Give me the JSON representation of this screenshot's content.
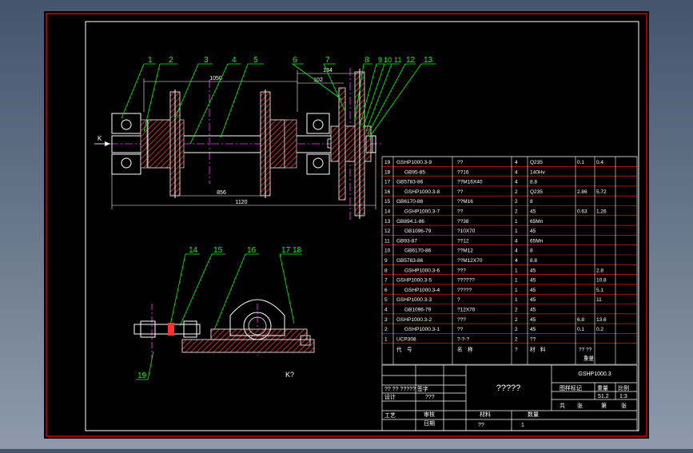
{
  "colors": {
    "background": "#000000",
    "frame": "#ff0000",
    "outline": "#ffffff",
    "leader": "#00ff00",
    "text": "#ffffff",
    "hatch": "#ff3030",
    "centerline": "#ff40ff",
    "dimension": "#ffffff"
  },
  "dimensions": {
    "d1050": "1050",
    "d134": "134",
    "d102": "102",
    "d856": "856",
    "d1120": "1120"
  },
  "balloons": {
    "b1": "1",
    "b2": "2",
    "b3": "3",
    "b4": "4",
    "b5": "5",
    "b6": "6",
    "b7": "7",
    "b8": "8",
    "b9": "9",
    "b10": "10",
    "b11": "11",
    "b12": "12",
    "b13": "13",
    "b14": "14",
    "b15": "15",
    "b16": "16",
    "b17": "17",
    "b18": "18",
    "b19": "19"
  },
  "view_labels": {
    "section": "K",
    "view": "K?"
  },
  "bom": {
    "rows": [
      {
        "no": "19",
        "code": "GSHP1000.3-9",
        "name": "??",
        "qty": "4",
        "mat": "Q235",
        "w1": "0.1",
        "w2": "0.4"
      },
      {
        "no": "18",
        "code": "GB95-85",
        "name": "??16",
        "qty": "4",
        "mat": "140Hv",
        "w1": "",
        "w2": ""
      },
      {
        "no": "17",
        "code": "GB5783-86",
        "name": "??M16X40",
        "qty": "4",
        "mat": "8.8",
        "w1": "",
        "w2": ""
      },
      {
        "no": "16",
        "code": "GSHP1000.3-8",
        "name": "??",
        "qty": "2",
        "mat": "Q235",
        "w1": "2.86",
        "w2": "5.72"
      },
      {
        "no": "15",
        "code": "GB6170-86",
        "name": "??M16",
        "qty": "2",
        "mat": "8",
        "w1": "",
        "w2": ""
      },
      {
        "no": "14",
        "code": "GSHP1000.3-7",
        "name": "??",
        "qty": "2",
        "mat": "45",
        "w1": "0.63",
        "w2": "1.26"
      },
      {
        "no": "13",
        "code": "GB894.1-86",
        "name": "??38",
        "qty": "1",
        "mat": "65Mn",
        "w1": "",
        "w2": ""
      },
      {
        "no": "12",
        "code": "GB1096-79",
        "name": "?10X70",
        "qty": "1",
        "mat": "45",
        "w1": "",
        "w2": ""
      },
      {
        "no": "11",
        "code": "GB93-87",
        "name": "??12",
        "qty": "4",
        "mat": "65Mn",
        "w1": "",
        "w2": ""
      },
      {
        "no": "10",
        "code": "GB6170-86",
        "name": "??M12",
        "qty": "4",
        "mat": "8",
        "w1": "",
        "w2": ""
      },
      {
        "no": "9",
        "code": "GB5783-86",
        "name": "??M12X70",
        "qty": "4",
        "mat": "8.8",
        "w1": "",
        "w2": ""
      },
      {
        "no": "8",
        "code": "GSHP1000.3-6",
        "name": "???",
        "qty": "1",
        "mat": "45",
        "w1": "",
        "w2": "2.8"
      },
      {
        "no": "7",
        "code": "GSHP1000.3-5",
        "name": "??????",
        "qty": "1",
        "mat": "45",
        "w1": "",
        "w2": "10.8"
      },
      {
        "no": "6",
        "code": "GSHP1000.3-4",
        "name": "?????",
        "qty": "1",
        "mat": "45",
        "w1": "",
        "w2": "5.1"
      },
      {
        "no": "5",
        "code": "GSHP1000.3-3",
        "name": "?",
        "qty": "1",
        "mat": "45",
        "w1": "",
        "w2": "11"
      },
      {
        "no": "4",
        "code": "GB1096-79",
        "name": "?12X70",
        "qty": "2",
        "mat": "45",
        "w1": "",
        "w2": ""
      },
      {
        "no": "3",
        "code": "GSHP1000.3-2",
        "name": "???",
        "qty": "2",
        "mat": "45",
        "w1": "6.8",
        "w2": "13.6"
      },
      {
        "no": "2",
        "code": "GSHP1000.3-1",
        "name": "??",
        "qty": "2",
        "mat": "45",
        "w1": "0.1",
        "w2": "0.2"
      },
      {
        "no": "1",
        "code": "UCP308",
        "name": "?-?-?",
        "qty": "2",
        "mat": "??",
        "w1": "",
        "w2": ""
      }
    ],
    "header": {
      "code": "代　号",
      "name": "名　称",
      "qty": "?",
      "mat": "材　料",
      "weight": "??  ??",
      "weight2": "重量"
    }
  },
  "title_block": {
    "drawing_no": "GSHP1000.3",
    "title": "?????",
    "stage_mark": "图样标记",
    "weight": "重量",
    "scale": "比例",
    "weight_val": "51.2",
    "scale_val": "1:3",
    "sheets": "共",
    "sheet": "张",
    "sheet_no": "第",
    "sheet_of": "张",
    "sign_row": "?? ?? ?????  签字",
    "design": "设计",
    "design_val": "???",
    "craft": "工艺",
    "check": "审核",
    "date": "日期",
    "material": "材料",
    "quantity": "数量",
    "material_val": "??",
    "quantity_val": "1"
  }
}
